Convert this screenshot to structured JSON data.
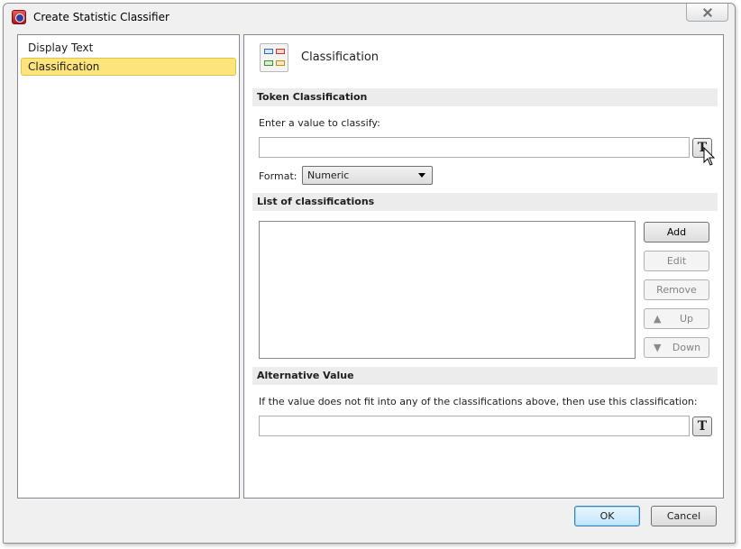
{
  "window": {
    "title": "Create Statistic Classifier"
  },
  "sidebar": {
    "items": [
      {
        "label": "Display Text",
        "selected": false
      },
      {
        "label": "Classification",
        "selected": true
      }
    ]
  },
  "header": {
    "title": "Classification",
    "icon": "classification-icon"
  },
  "token_section": {
    "title": "Token Classification",
    "prompt": "Enter a value to classify:",
    "value": "",
    "token_button_label": "T",
    "format_label": "Format:",
    "format_value": "Numeric"
  },
  "list_section": {
    "title": "List of classifications",
    "items": [],
    "buttons": {
      "add": "Add",
      "edit": "Edit",
      "remove": "Remove",
      "up": "Up",
      "down": "Down"
    }
  },
  "alternative_section": {
    "title": "Alternative Value",
    "prompt": "If the value does not fit into any of the classifications above, then use this classification:",
    "value": "",
    "token_button_label": "T"
  },
  "footer": {
    "ok": "OK",
    "cancel": "Cancel"
  },
  "colors": {
    "selection": "#fde57b",
    "section_bar": "#ececec",
    "default_button": "#bee6fd"
  }
}
